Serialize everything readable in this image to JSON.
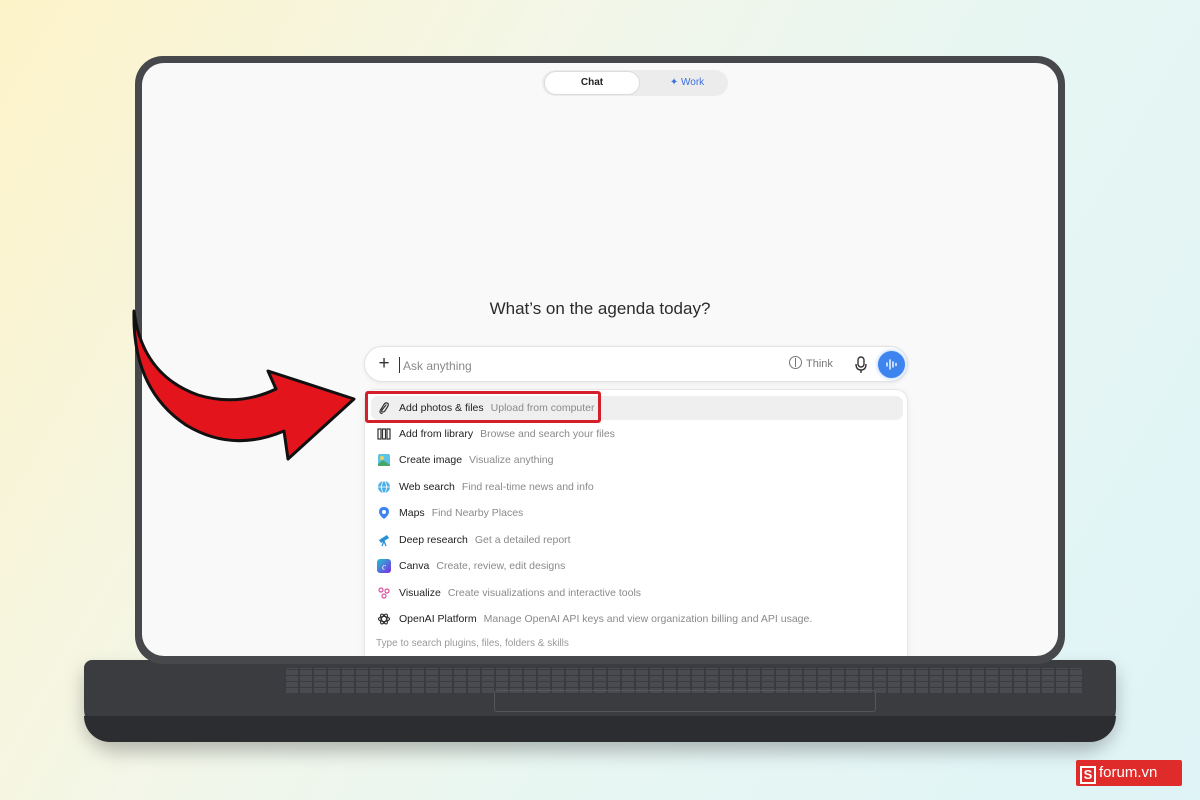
{
  "mode_toggle": {
    "chat_label": "Chat",
    "work_label": "✦ Work"
  },
  "headline": "What’s on the agenda today?",
  "prompt": {
    "placeholder": "Ask anything",
    "think_label": "Think"
  },
  "menu": {
    "items": [
      {
        "title": "Add photos & files",
        "description": "Upload from computer",
        "icon": "paperclip-icon"
      },
      {
        "title": "Add from library",
        "description": "Browse and search your files",
        "icon": "library-icon"
      },
      {
        "title": "Create image",
        "description": "Visualize anything",
        "icon": "image-icon"
      },
      {
        "title": "Web search",
        "description": "Find real-time news and info",
        "icon": "globe-icon"
      },
      {
        "title": "Maps",
        "description": "Find Nearby Places",
        "icon": "map-pin-icon"
      },
      {
        "title": "Deep research",
        "description": "Get a detailed report",
        "icon": "telescope-icon"
      },
      {
        "title": "Canva",
        "description": "Create, review, edit designs",
        "icon": "canva-icon"
      },
      {
        "title": "Visualize",
        "description": "Create visualizations and interactive tools",
        "icon": "visualize-icon"
      },
      {
        "title": "OpenAI Platform",
        "description": "Manage OpenAI API keys and view organization billing and API usage.",
        "icon": "openai-icon"
      }
    ],
    "hint": "Type to search plugins, files, folders & skills"
  },
  "watermark": {
    "letter": "S",
    "text": "forum.vn"
  },
  "colors": {
    "accent": "#3e84ef",
    "highlight": "#d3202b",
    "arrow": "#e3141b"
  }
}
